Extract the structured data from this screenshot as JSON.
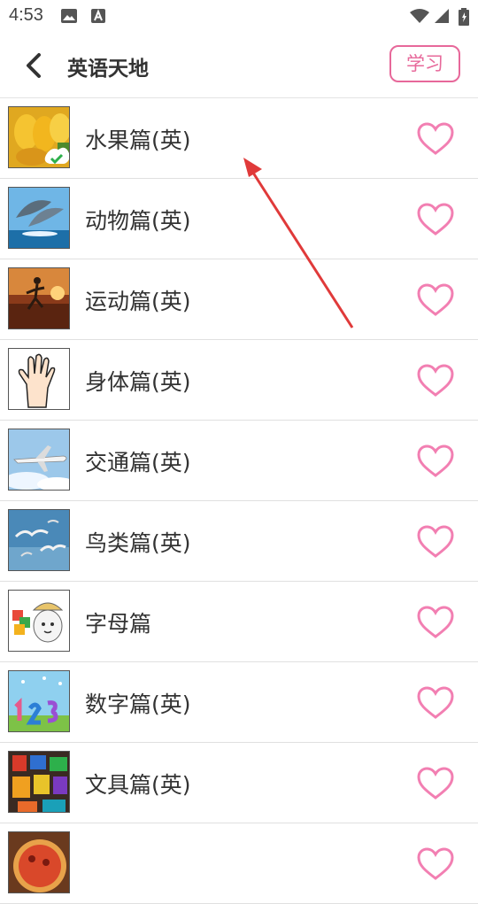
{
  "status_bar": {
    "time": "4:53"
  },
  "header": {
    "title": "英语天地",
    "learn_button": "学习"
  },
  "items": [
    {
      "label": "水果篇(英)",
      "icon": "fruit-mango-icon"
    },
    {
      "label": "动物篇(英)",
      "icon": "dolphin-icon"
    },
    {
      "label": "运动篇(英)",
      "icon": "runner-icon"
    },
    {
      "label": "身体篇(英)",
      "icon": "hand-icon"
    },
    {
      "label": "交通篇(英)",
      "icon": "airplane-icon"
    },
    {
      "label": "鸟类篇(英)",
      "icon": "seagull-icon"
    },
    {
      "label": "字母篇",
      "icon": "alphabet-cartoon-icon"
    },
    {
      "label": "数字篇(英)",
      "icon": "numbers-icon"
    },
    {
      "label": "文具篇(英)",
      "icon": "paint-supplies-icon"
    },
    {
      "label": "",
      "icon": "pizza-icon"
    }
  ],
  "colors": {
    "accent": "#e7689a",
    "heart": "#f27fb2",
    "annotation_arrow": "#e03a3a"
  }
}
